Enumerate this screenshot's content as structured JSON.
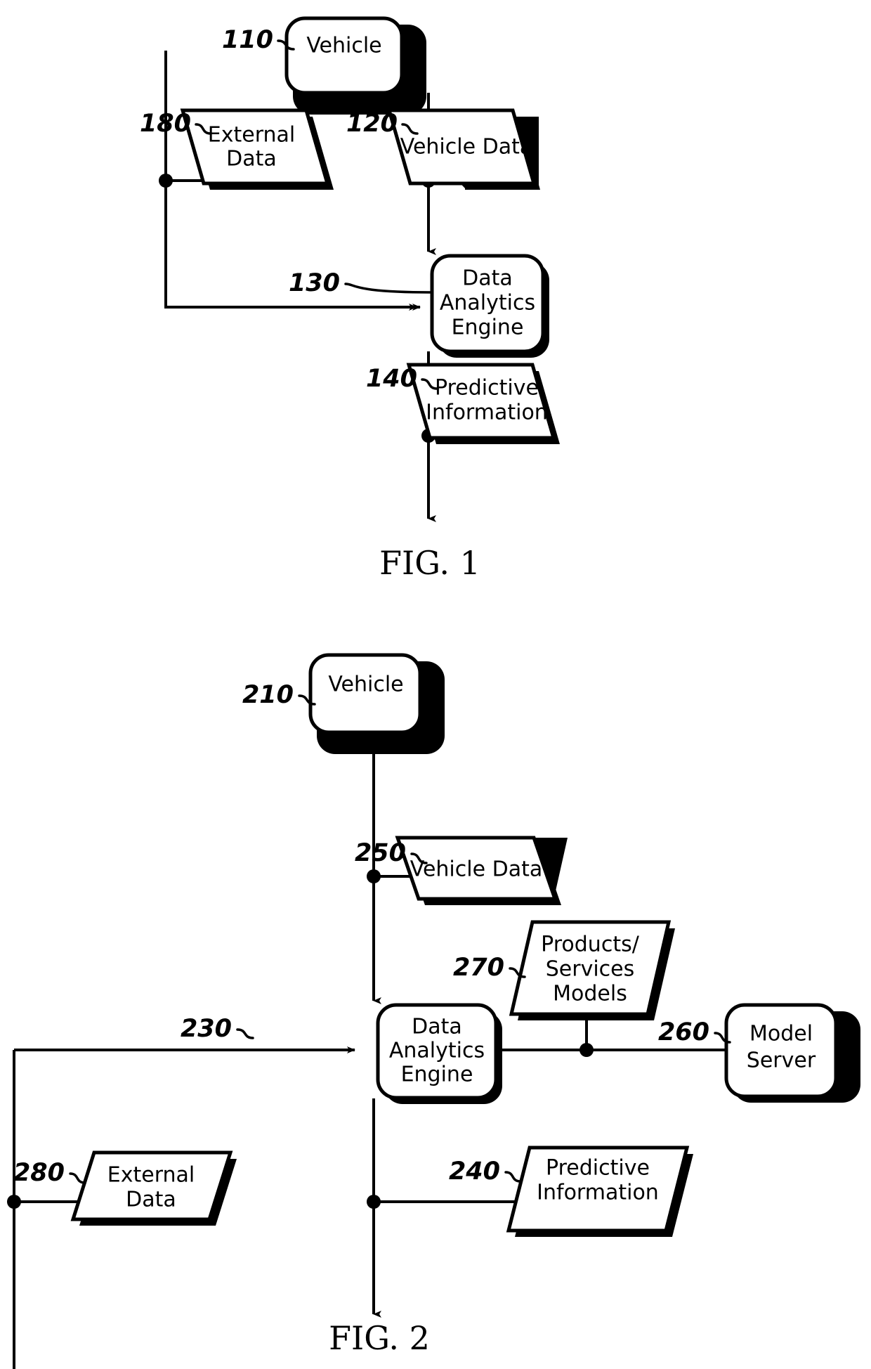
{
  "figures": [
    {
      "id": "fig1",
      "caption": "FIG. 1",
      "nodes": {
        "vehicle": {
          "label": "Vehicle",
          "ref": "110",
          "shape": "rounded-rect"
        },
        "external_data": {
          "label_line1": "External",
          "label_line2": "Data",
          "ref": "180",
          "shape": "parallelogram"
        },
        "vehicle_data": {
          "label": "Vehicle Data",
          "ref": "120",
          "shape": "parallelogram"
        },
        "engine": {
          "label_line1": "Data",
          "label_line2": "Analytics",
          "label_line3": "Engine",
          "ref": "130",
          "shape": "rounded-rect"
        },
        "predictive_information": {
          "label_line1": "Predictive",
          "label_line2": "Information",
          "ref": "140",
          "shape": "parallelogram"
        }
      }
    },
    {
      "id": "fig2",
      "caption": "FIG. 2",
      "nodes": {
        "vehicle": {
          "label": "Vehicle",
          "ref": "210",
          "shape": "rounded-rect"
        },
        "vehicle_data": {
          "label": "Vehicle Data",
          "ref": "250",
          "shape": "parallelogram"
        },
        "products_services_models": {
          "label_line1": "Products/",
          "label_line2": "Services",
          "label_line3": "Models",
          "ref": "270",
          "shape": "parallelogram"
        },
        "engine": {
          "label_line1": "Data",
          "label_line2": "Analytics",
          "label_line3": "Engine",
          "ref": "230",
          "shape": "rounded-rect"
        },
        "model_server": {
          "label_line1": "Model",
          "label_line2": "Server",
          "ref": "260",
          "shape": "rounded-rect"
        },
        "external_data": {
          "label_line1": "External",
          "label_line2": "Data",
          "ref": "280",
          "shape": "parallelogram"
        },
        "predictive_information": {
          "label_line1": "Predictive",
          "label_line2": "Information",
          "ref": "240",
          "shape": "parallelogram"
        }
      }
    }
  ],
  "colors": {
    "ink": "#000000",
    "paper": "#ffffff"
  }
}
